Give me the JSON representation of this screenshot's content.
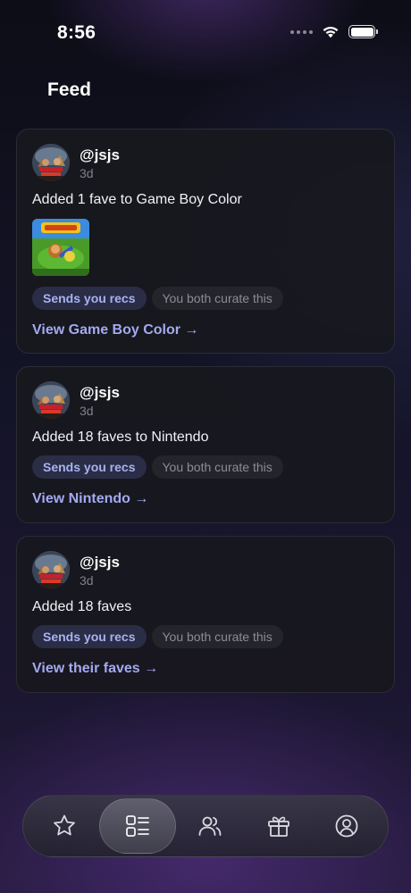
{
  "status_bar": {
    "time": "8:56",
    "icons": [
      "signal-icon",
      "wifi-icon",
      "battery-icon"
    ],
    "battery_level": 1.0
  },
  "page_title": "Feed",
  "feed": [
    {
      "username": "@jsjs",
      "time_ago": "3d",
      "activity": "Added 1 fave to Game Boy Color",
      "has_cover_art": true,
      "tags": [
        "Sends you recs",
        "You both curate this"
      ],
      "link": "View Game Boy Color →"
    },
    {
      "username": "@jsjs",
      "time_ago": "3d",
      "activity": "Added 18 faves to Nintendo",
      "has_cover_art": false,
      "tags": [
        "Sends you recs",
        "You both curate this"
      ],
      "link": "View Nintendo →"
    },
    {
      "username": "@jsjs",
      "time_ago": "3d",
      "activity": "Added 18 faves",
      "has_cover_art": false,
      "tags": [
        "Sends you recs",
        "You both curate this"
      ],
      "link": "View their faves →"
    }
  ],
  "tab_bar": {
    "tabs": [
      {
        "icon": "star-icon",
        "active": false
      },
      {
        "icon": "feed-list-icon",
        "active": true
      },
      {
        "icon": "people-icon",
        "active": false
      },
      {
        "icon": "gift-icon",
        "active": false
      },
      {
        "icon": "profile-icon",
        "active": false
      }
    ]
  },
  "colors": {
    "accent_link": "#a3aaf0",
    "tag_primary_bg": "#2a2d45",
    "tag_primary_text": "#a8b2f2",
    "tag_secondary_bg": "#24242b",
    "tag_secondary_text": "#8c8c96",
    "card_bg": "#18181e"
  }
}
